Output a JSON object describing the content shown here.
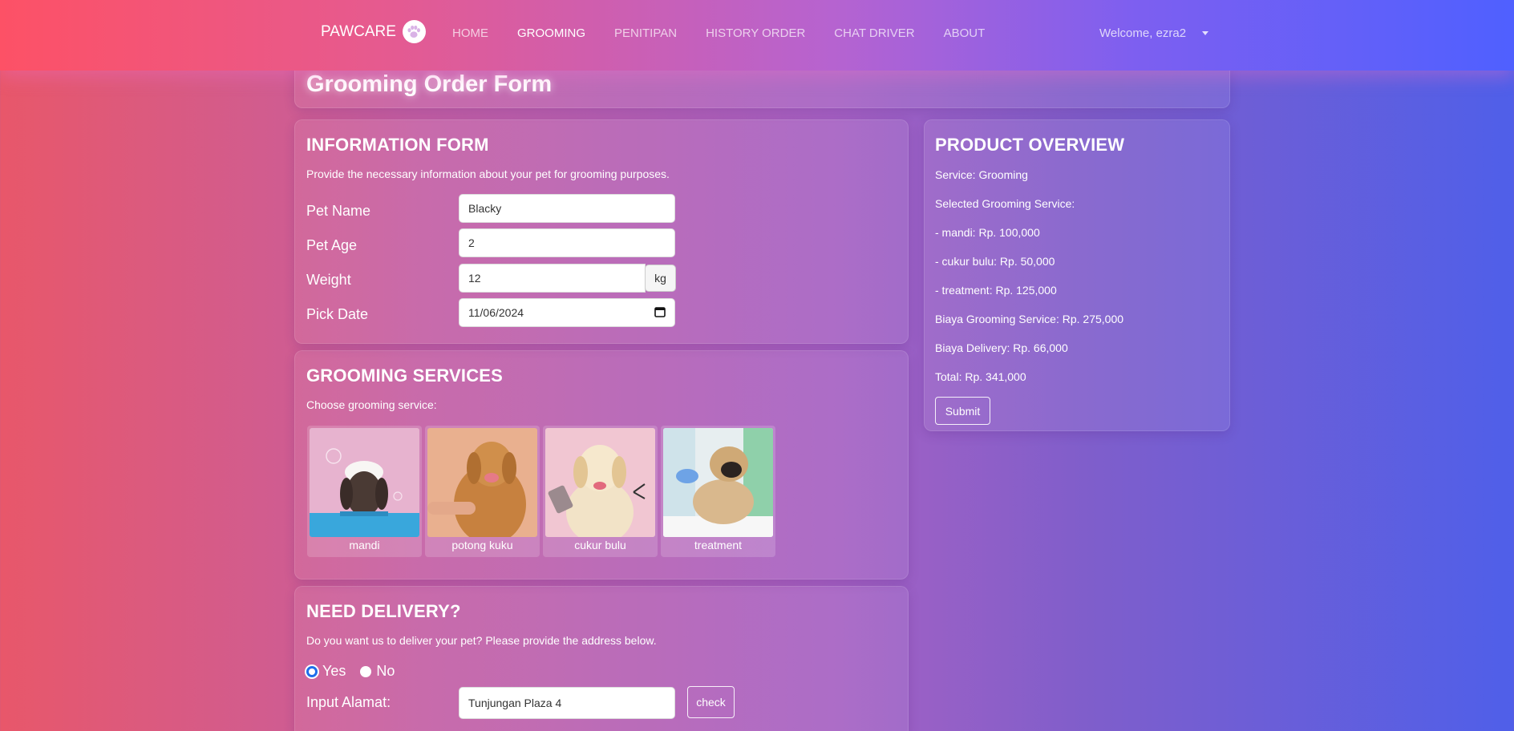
{
  "navbar": {
    "brand": "PAWCARE",
    "brand_icon": "paw-icon",
    "links": [
      "HOME",
      "GROOMING",
      "PENITIPAN",
      "HISTORY ORDER",
      "CHAT DRIVER",
      "ABOUT"
    ],
    "active_link": "GROOMING",
    "user_menu": "Welcome, ezra2"
  },
  "page_title": "Grooming Order Form",
  "info_form": {
    "title": "INFORMATION FORM",
    "description": "Provide the necessary information about your pet for grooming purposes.",
    "fields": {
      "pet_name": {
        "label": "Pet Name",
        "value": "Blacky"
      },
      "pet_age": {
        "label": "Pet Age",
        "value": "2"
      },
      "weight": {
        "label": "Weight",
        "value": "12",
        "unit": "kg"
      },
      "pick_date": {
        "label": "Pick Date",
        "value": "11/06/2024"
      }
    }
  },
  "services": {
    "title": "GROOMING SERVICES",
    "description": "Choose grooming service:",
    "items": [
      {
        "label": "mandi"
      },
      {
        "label": "potong kuku"
      },
      {
        "label": "cukur bulu"
      },
      {
        "label": "treatment"
      }
    ]
  },
  "delivery": {
    "title": "NEED DELIVERY?",
    "description": "Do you want us to deliver your pet? Please provide the address below.",
    "options": {
      "yes": "Yes",
      "no": "No"
    },
    "selected": "Yes",
    "address_label": "Input Alamat:",
    "address_value": "Tunjungan Plaza 4",
    "check_label": "check"
  },
  "overview": {
    "title": "PRODUCT OVERVIEW",
    "service": "Service: Grooming",
    "selected_header": "Selected Grooming Service:",
    "selected_items": [
      "- mandi: Rp. 100,000",
      "- cukur bulu: Rp. 50,000",
      "- treatment: Rp. 125,000"
    ],
    "service_cost": "Biaya Grooming Service: Rp. 275,000",
    "delivery_cost": "Biaya Delivery: Rp. 66,000",
    "total": "Total: Rp. 341,000",
    "submit_label": "Submit"
  }
}
